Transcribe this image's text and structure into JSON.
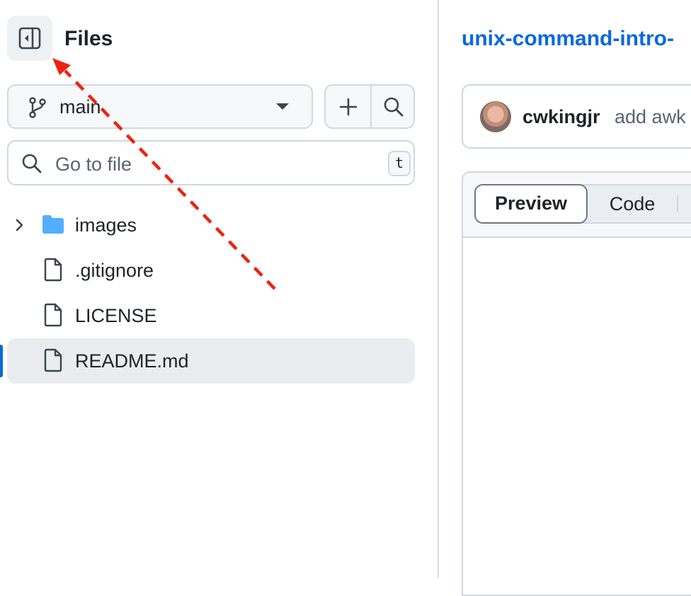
{
  "sidebar": {
    "title": "Files",
    "branch": "main",
    "goto_placeholder": "Go to file",
    "goto_shortcut": "t",
    "tree": [
      {
        "label": "images",
        "type": "folder"
      },
      {
        "label": ".gitignore",
        "type": "file"
      },
      {
        "label": "LICENSE",
        "type": "file"
      },
      {
        "label": "README.md",
        "type": "file",
        "selected": true
      }
    ]
  },
  "main": {
    "repo_title": "unix-command-intro-",
    "commit": {
      "user": "cwkingjr",
      "message": "add awk"
    },
    "tabs": {
      "preview": "Preview",
      "code": "Code",
      "active": "Preview"
    }
  },
  "colors": {
    "accent": "#0969da",
    "annotation_arrow": "#ee2211"
  },
  "icons": [
    "sidebar-collapse-icon",
    "git-branch-icon",
    "caret-down-icon",
    "plus-icon",
    "search-icon",
    "chevron-right-icon",
    "folder-icon",
    "file-icon"
  ]
}
